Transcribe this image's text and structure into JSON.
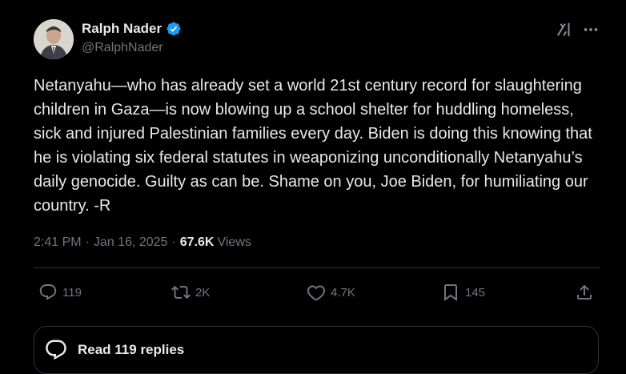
{
  "author": {
    "name": "Ralph Nader",
    "handle": "@RalphNader",
    "verified": true
  },
  "tweet": {
    "text": "Netanyahu—who has already set a world 21st century record for slaughtering children in Gaza—is now blowing up a school shelter for huddling homeless, sick and injured Palestinian families every day. Biden is doing this knowing that he is violating six federal statutes in weaponizing unconditionally Netanyahu’s daily genocide. Guilty as can be. Shame on you, Joe Biden, for humiliating our country. -R",
    "time": "2:41 PM",
    "date": "Jan 16, 2025",
    "separator": "·",
    "views_count": "67.6K",
    "views_label": "Views"
  },
  "actions": {
    "reply_count": "119",
    "repost_count": "2K",
    "like_count": "4.7K",
    "bookmark_count": "145"
  },
  "replies_button": {
    "label": "Read 119 replies"
  },
  "icons": {
    "verified": "verified-badge-icon",
    "grok": "grok-icon",
    "more": "more-icon",
    "reply": "reply-icon",
    "repost": "repost-icon",
    "like": "heart-icon",
    "bookmark": "bookmark-icon",
    "share": "share-icon"
  },
  "colors": {
    "background": "#000000",
    "text": "#e7e9ea",
    "muted": "#71767b",
    "border": "#2f3336",
    "verified": "#1d9bf0"
  }
}
